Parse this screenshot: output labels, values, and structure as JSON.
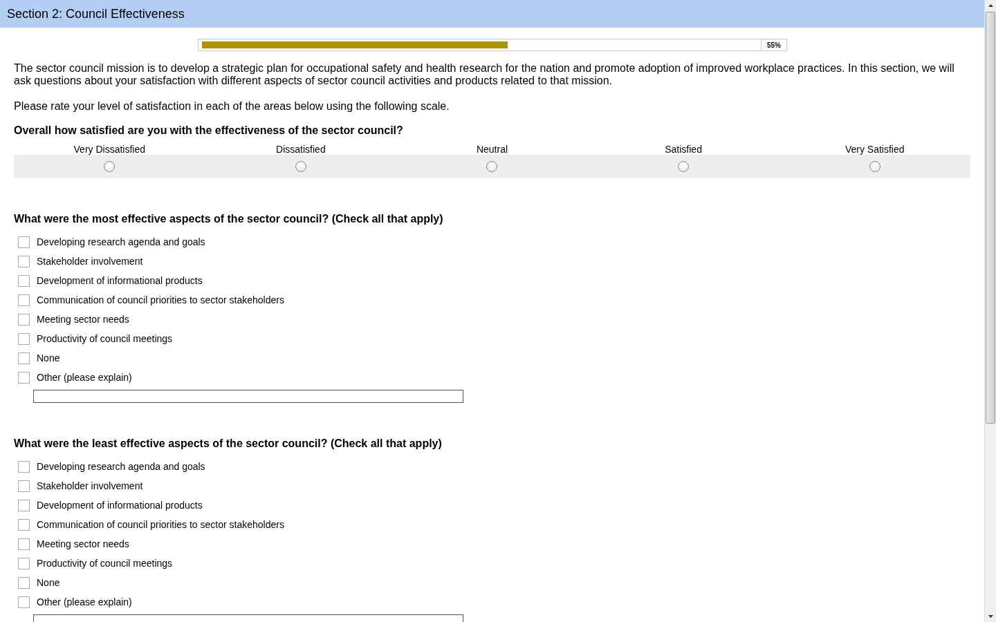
{
  "header": {
    "title": "Section 2: Council Effectiveness"
  },
  "progress": {
    "level": 0.55,
    "reading": "55%"
  },
  "intro": [
    "The sector council mission is to develop a strategic plan for occupational safety and health research for the nation and promote adoption of improved workplace practices. In this section, we will ask questions about your satisfaction with different aspects of sector council activities and products related to that mission.",
    "Please rate your level of satisfaction in each of the areas below using the following scale."
  ],
  "questions": [
    {
      "kind": "rating",
      "prompt": "Overall how satisfied are you with the effectiveness of the sector council?",
      "options": [
        {
          "label": "Very Dissatisfied",
          "selected": false
        },
        {
          "label": "Dissatisfied",
          "selected": false
        },
        {
          "label": "Neutral",
          "selected": false
        },
        {
          "label": "Satisfied",
          "selected": false
        },
        {
          "label": "Very Satisfied",
          "selected": false
        }
      ]
    },
    {
      "kind": "checklist",
      "prompt": "What were the most effective aspects of the sector council? (Check all that apply)",
      "options": [
        {
          "label": "Developing research agenda and goals",
          "checked": false
        },
        {
          "label": "Stakeholder involvement",
          "checked": false
        },
        {
          "label": "Development of informational products",
          "checked": false
        },
        {
          "label": "Communication of council priorities to sector stakeholders",
          "checked": false
        },
        {
          "label": "Meeting sector needs",
          "checked": false
        },
        {
          "label": "Productivity of council meetings",
          "checked": false
        },
        {
          "label": "None",
          "checked": false
        },
        {
          "label": "Other (please explain)",
          "checked": false
        }
      ]
    },
    {
      "kind": "checklist",
      "prompt": "What were the least effective aspects of the sector council? (Check all that apply)",
      "options": [
        {
          "label": "Developing research agenda and goals",
          "checked": false
        },
        {
          "label": "Stakeholder involvement",
          "checked": false
        },
        {
          "label": "Development of informational products",
          "checked": false
        },
        {
          "label": "Communication of council priorities to sector stakeholders",
          "checked": false
        },
        {
          "label": "Meeting sector needs",
          "checked": false
        },
        {
          "label": "Productivity of council meetings",
          "checked": false
        },
        {
          "label": "None",
          "checked": false
        },
        {
          "label": "Other (please explain)",
          "checked": false
        }
      ]
    }
  ]
}
